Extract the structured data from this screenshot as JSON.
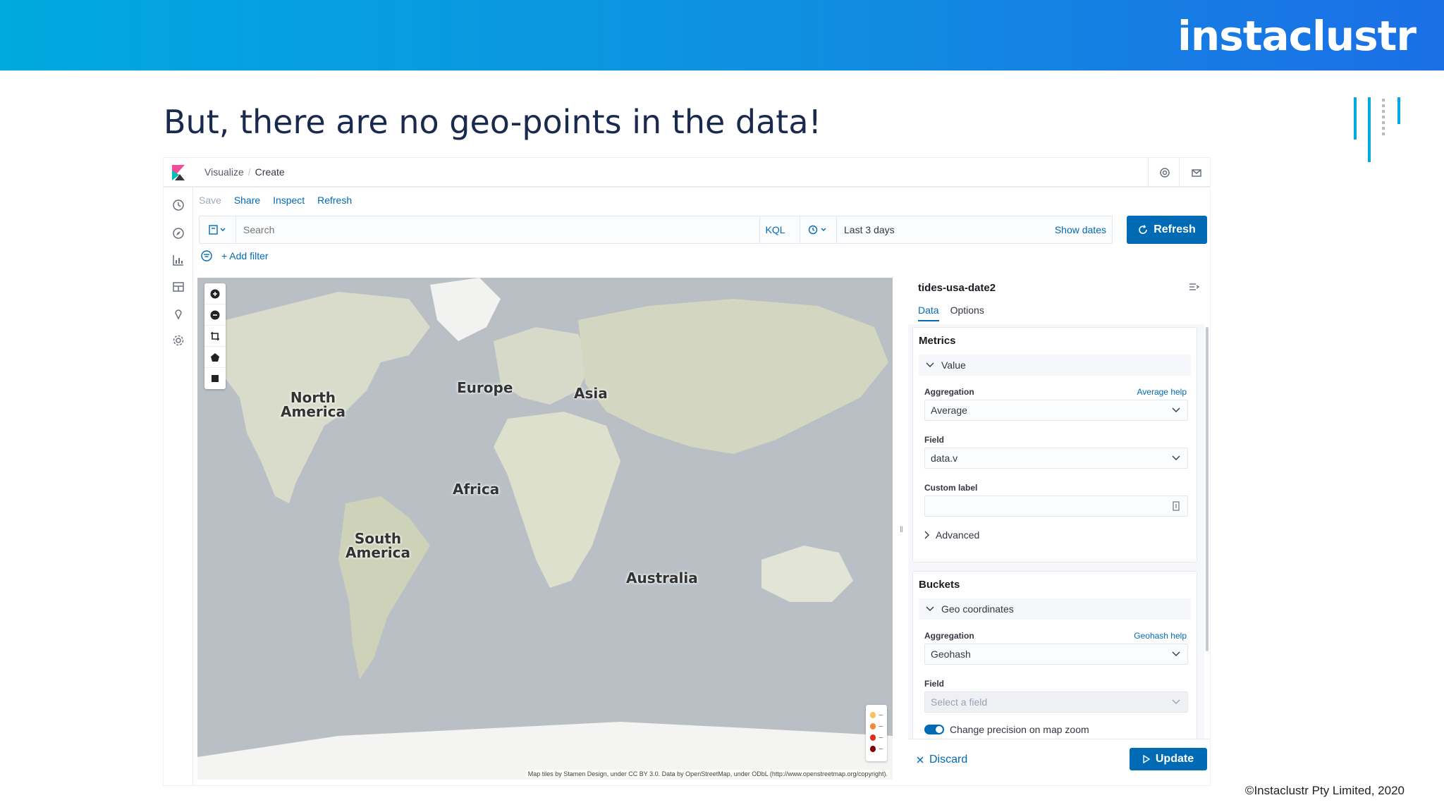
{
  "slide": {
    "brand": "instaclustr",
    "title": "But, there are no geo-points in the data!",
    "copyright": "©Instaclustr Pty Limited, 2020"
  },
  "header": {
    "breadcrumbs": [
      "Visualize",
      "Create"
    ]
  },
  "toolbar_links": [
    "Save",
    "Share",
    "Inspect",
    "Refresh"
  ],
  "query": {
    "search_placeholder": "Search",
    "language": "KQL",
    "time_range": "Last 3 days",
    "show_dates": "Show dates",
    "refresh_label": "Refresh"
  },
  "filters": {
    "add_filter": "+ Add filter"
  },
  "map": {
    "labels": [
      {
        "text": "North\nAmerica"
      },
      {
        "text": "Europe"
      },
      {
        "text": "Asia"
      },
      {
        "text": "Africa"
      },
      {
        "text": "South\nAmerica"
      },
      {
        "text": "Australia"
      }
    ],
    "attribution": "Map tiles by Stamen Design, under CC BY 3.0. Data by OpenStreetMap, under ODbL (http://www.openstreetmap.org/copyright).",
    "legend_colors": [
      "#f6c15f",
      "#f08a3c",
      "#d7301f",
      "#7f0000"
    ],
    "legend_dash": "–"
  },
  "editor": {
    "index_pattern": "tides-usa-date2",
    "tabs": [
      "Data",
      "Options"
    ],
    "active_tab": "Data",
    "metrics": {
      "title": "Metrics",
      "item": "Value",
      "aggregation_label": "Aggregation",
      "aggregation_help": "Average help",
      "aggregation_value": "Average",
      "field_label": "Field",
      "field_value": "data.v",
      "custom_label": "Custom label",
      "custom_value": "",
      "advanced": "Advanced"
    },
    "buckets": {
      "title": "Buckets",
      "item": "Geo coordinates",
      "aggregation_label": "Aggregation",
      "aggregation_help": "Geohash help",
      "aggregation_value": "Geohash",
      "field_label": "Field",
      "field_placeholder": "Select a field",
      "precision_toggle": "Change precision on map zoom"
    },
    "discard": "Discard",
    "update": "Update"
  }
}
